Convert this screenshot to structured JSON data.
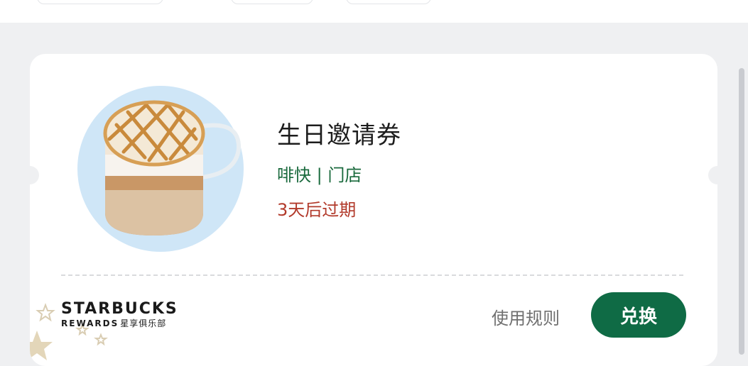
{
  "coupon": {
    "title": "生日邀请券",
    "tags": "啡快 | 门店",
    "expiry": "3天后过期"
  },
  "brand": {
    "name": "STARBUCKS",
    "subtitle": "REWARDS",
    "subtitle_cn": "星享俱乐部"
  },
  "actions": {
    "rules_label": "使用规则",
    "redeem_label": "兑换"
  },
  "colors": {
    "accent_green": "#0f6b45",
    "tag_green": "#1a6a3d",
    "expiry_red": "#b23a2b",
    "image_bg_blue": "#cfe6f7"
  },
  "icons": {
    "product_image": "caramel-macchiato-cup-icon",
    "decoration": "star-icon"
  }
}
